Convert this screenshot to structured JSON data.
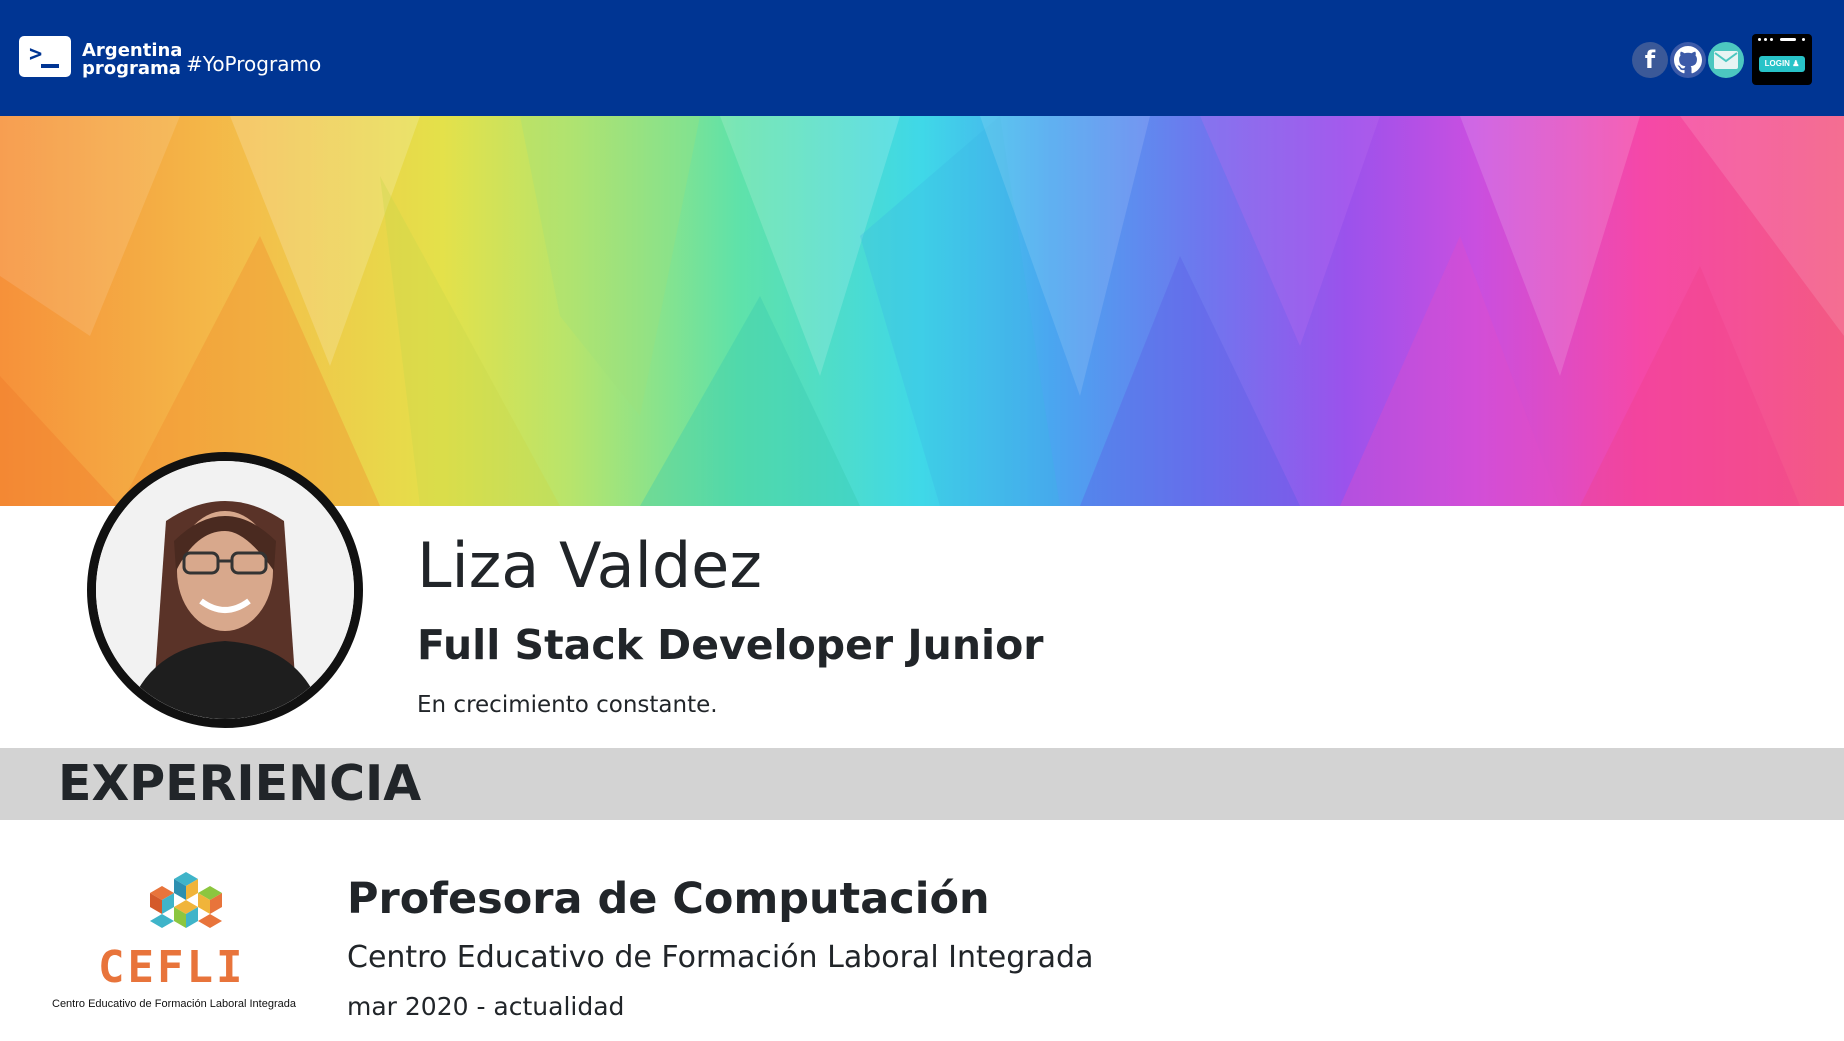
{
  "navbar": {
    "brand_line1": "Argentina",
    "brand_line2": "programa",
    "hashtag": "#YoProgramo",
    "background": "#003593",
    "social": [
      {
        "icon": "facebook-icon",
        "label": "f",
        "color": "#3b5998"
      },
      {
        "icon": "github-icon",
        "color": "#3c5aa8"
      },
      {
        "icon": "mail-icon",
        "color": "#4cc7c0"
      }
    ],
    "login_label": "LOGIN"
  },
  "banner": {
    "colors": [
      "#f6913a",
      "#f3c04b",
      "#e4e14a",
      "#5fe2a9",
      "#3fd8e8",
      "#6d78ee",
      "#9b52ec",
      "#f548a8",
      "#f35a82"
    ]
  },
  "profile": {
    "name": "Liza Valdez",
    "role": "Full Stack Developer Junior",
    "tagline": "En crecimiento constante."
  },
  "section": {
    "title": "EXPERIENCIA",
    "background": "#d3d3d3"
  },
  "experience": [
    {
      "title": "Profesora de Computación",
      "organization": "Centro Educativo de Formación Laboral Integrada",
      "dates": "mar 2020 - actualidad",
      "logo_wordmark": "CEFLI",
      "logo_caption": "Centro Educativo de Formación Laboral Integrada",
      "logo_color": "#e8743b"
    }
  ]
}
